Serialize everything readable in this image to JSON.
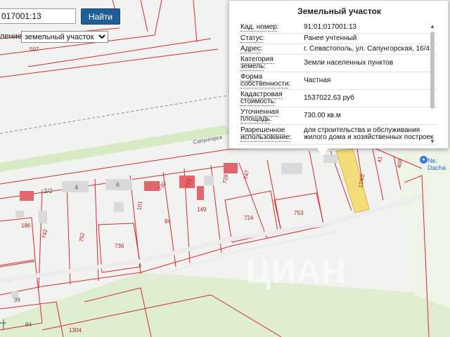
{
  "search": {
    "value": "017001:13",
    "button_label": "Найти"
  },
  "layer": {
    "label": "ление:",
    "selected": "земельный участок"
  },
  "popup": {
    "title": "Земельный участок",
    "rows": [
      {
        "key": "Кад. номер",
        "value": "91:01:017001:13"
      },
      {
        "key": "Статус",
        "value": "Ранее учтенный"
      },
      {
        "key": "Адрес",
        "value": "г. Севастополь, ул. Сапунгорская, 16/4"
      },
      {
        "key": "Категория земель",
        "value": "Земли населенных пунктов"
      },
      {
        "key": "Форма собственности",
        "value": "Частная"
      },
      {
        "key": "Кадастровая стоимость",
        "value": "1537022.63 руб"
      },
      {
        "key": "Уточненная площадь",
        "value": "730.00 кв.м"
      },
      {
        "key": "Разрешенное использование",
        "value": "для строительства и обслуживания жилого дома и хозяйственных построек"
      }
    ]
  },
  "map": {
    "plot_labels": [
      "507",
      "186",
      "742",
      "752",
      "736",
      "101",
      "84",
      "149",
      "724",
      "753",
      "1304",
      "98",
      "94",
      "730",
      "723",
      "728",
      "747",
      "124/2",
      "41",
      "408"
    ],
    "building_labels": [
      "2/2",
      "4",
      "6"
    ],
    "street_label": "Сапунгорск",
    "poi_label": "Ne. Dacha",
    "watermark": "ЦИАН"
  },
  "colors": {
    "parcel_border": "#d22c2c",
    "building": "#e2676c",
    "highlight": "#f3dd7a",
    "search_button": "#1f5f96",
    "green": "#d4e8c0"
  }
}
